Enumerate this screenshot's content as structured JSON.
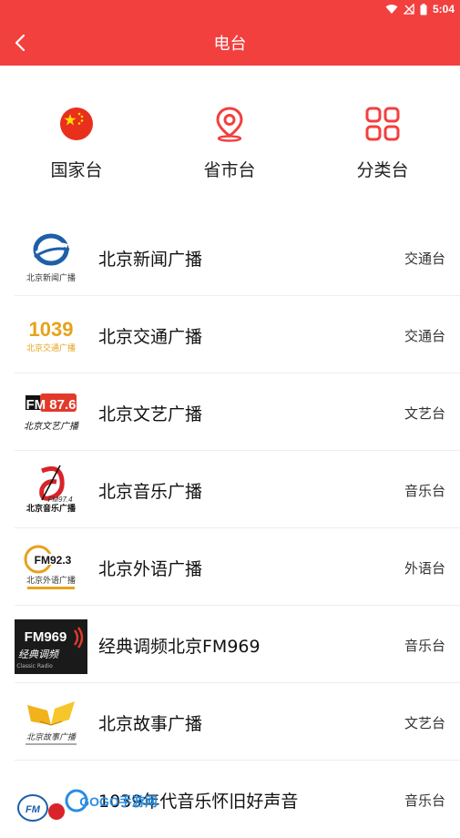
{
  "status": {
    "time": "5:04"
  },
  "header": {
    "title": "电台"
  },
  "categories": [
    {
      "label": "国家台",
      "icon": "china-flag-icon"
    },
    {
      "label": "省市台",
      "icon": "location-pin-icon"
    },
    {
      "label": "分类台",
      "icon": "grid-icon"
    }
  ],
  "stations": [
    {
      "name": "北京新闻广播",
      "category": "交通台",
      "logo_text": "北京新闻广播"
    },
    {
      "name": "北京交通广播",
      "category": "交通台",
      "logo_text": "1039",
      "logo_sub": "北京交通广播"
    },
    {
      "name": "北京文艺广播",
      "category": "文艺台",
      "logo_text": "FM 87.6",
      "logo_sub": "北京文艺广播"
    },
    {
      "name": "北京音乐广播",
      "category": "音乐台",
      "logo_text": "FM97.4",
      "logo_sub": "北京音乐广播"
    },
    {
      "name": "北京外语广播",
      "category": "外语台",
      "logo_text": "FM92.3",
      "logo_sub": "北京外语广播"
    },
    {
      "name": "经典调频北京FM969",
      "category": "音乐台",
      "logo_text": "FM969",
      "logo_sub": "经典调频",
      "logo_sub2": "Classic Radio"
    },
    {
      "name": "北京故事广播",
      "category": "文艺台",
      "logo_sub": "北京故事广播"
    },
    {
      "name": "1039年代音乐怀旧好声音",
      "category": "音乐台",
      "logo_text": "FM"
    }
  ],
  "watermark": {
    "text": "GOGO手游网"
  },
  "colors": {
    "accent": "#f2403f",
    "logo_orange": "#e6a21b",
    "logo_blue": "#1e5fa8"
  }
}
